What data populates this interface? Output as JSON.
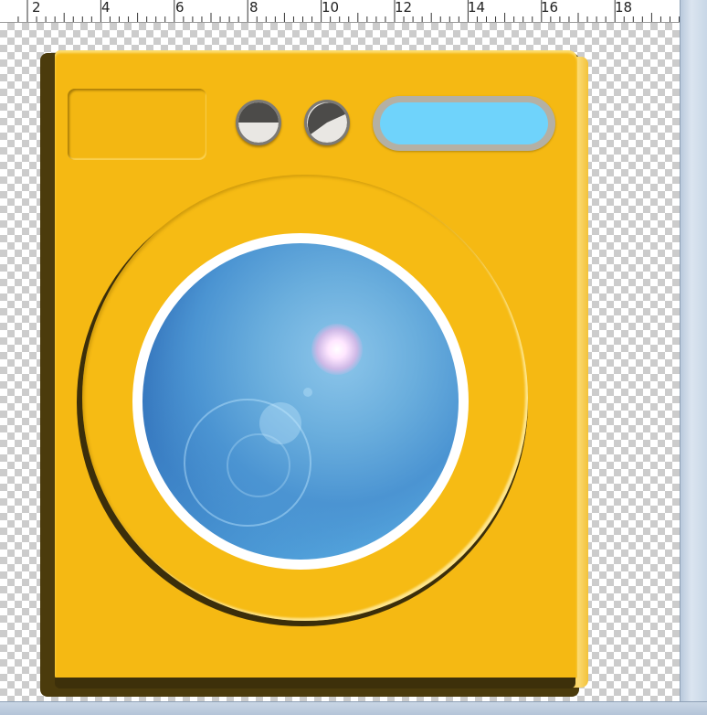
{
  "ruler": {
    "labels": [
      "2",
      "4",
      "6",
      "8",
      "10",
      "12",
      "14",
      "16",
      "18"
    ]
  },
  "colors": {
    "machine_body": "#f5b913",
    "machine_shadow": "#4b3b0c",
    "display_screen": "#6fd3fb",
    "glass_dark": "#2b65b1",
    "glass_light": "#5db3e6",
    "knob": "#7c7a76"
  },
  "illustration": {
    "subject": "washing-machine",
    "knob_1_icon": "dial-knob-icon",
    "knob_2_icon": "dial-knob-icon"
  }
}
